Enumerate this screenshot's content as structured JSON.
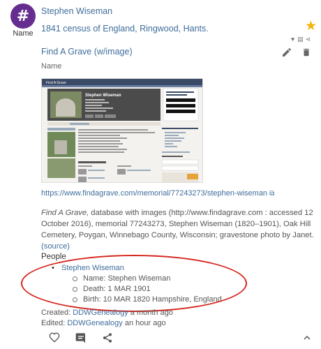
{
  "avatar": {
    "glyph": "#",
    "label": "Name",
    "color": "#652d90"
  },
  "header": {
    "title": "Stephen Wiseman",
    "subtitle": "1841 census of England, Ringwood, Hants.",
    "star_color": "#f2b40a"
  },
  "attachment": {
    "title": "Find A Grave (w/image)",
    "type_label": "Name",
    "url": "https://www.findagrave.com/memorial/77243273/stephen-wiseman",
    "thumbnail": {
      "site_name": "Find A Grave",
      "person": "Stephen Wiseman"
    }
  },
  "citation": {
    "source": "Find A Grave,",
    "text": " database with images (http://www.findagrave.com : accessed 12 October 2016), memorial 77243273, Stephen Wiseman (1820–1901), Oak Hill Cemetery, Poygan, Winnebago County, Wisconsin; gravestone photo by Janet.",
    "source_link": "(source)"
  },
  "people": {
    "label": "People",
    "person": "Stephen Wiseman",
    "facts": [
      "Name: Stephen Wiseman",
      "Death: 1 MAR 1901",
      "Birth: 10 MAR 1820 Hampshire, England"
    ]
  },
  "meta": {
    "created_prefix": "Created: ",
    "created_by": "DDWGenealogy",
    "created_when": " a month ago",
    "edited_prefix": "Edited: ",
    "edited_by": "DDWGenealogy",
    "edited_when": " an hour ago"
  },
  "accent_color": "#3f6d9c",
  "highlight_color": "#d6261e"
}
